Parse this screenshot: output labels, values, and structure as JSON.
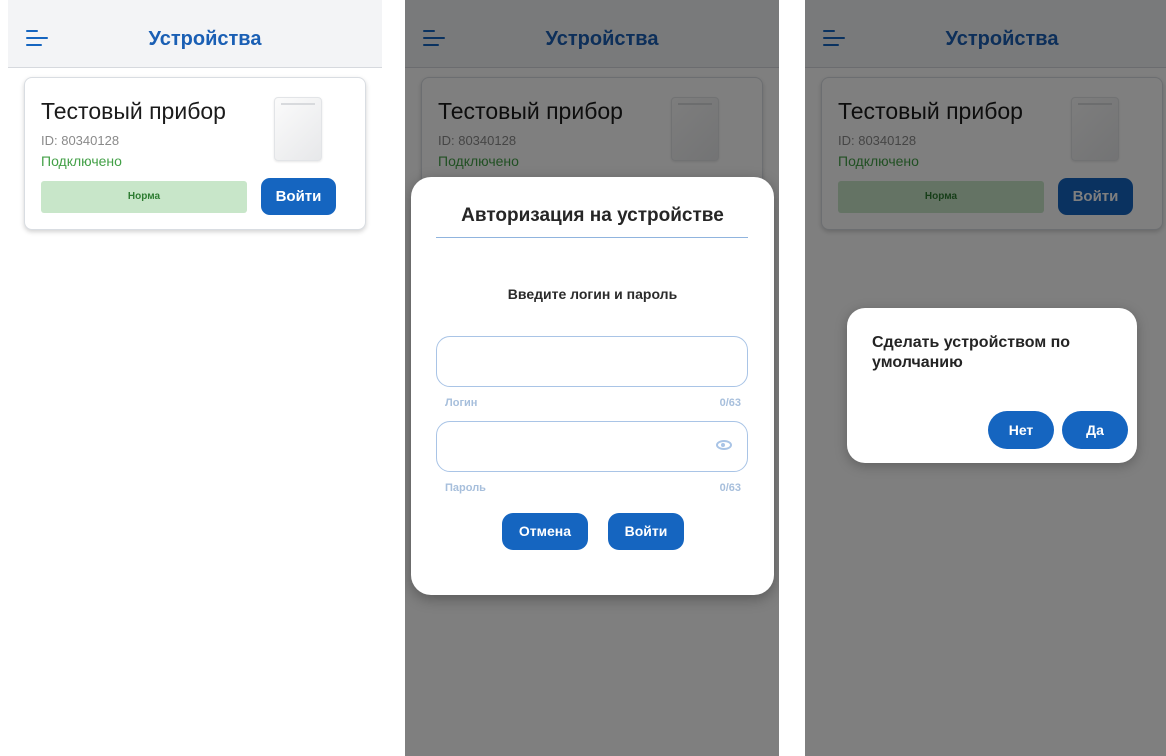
{
  "appbar": {
    "title": "Устройства",
    "menu_icon": "menu-icon"
  },
  "device": {
    "name": "Тестовый прибор",
    "id_text": "ID: 80340128",
    "status": "Подключено",
    "norm_label": "Норма",
    "login_label": "Войти"
  },
  "auth_dialog": {
    "title": "Авторизация на устройстве",
    "subtitle": "Введите логин и пароль",
    "login_field": {
      "value": "",
      "helper": "Логин",
      "counter": "0/63"
    },
    "password_field": {
      "value": "",
      "helper": "Пароль",
      "counter": "0/63",
      "icon": "eye-icon"
    },
    "cancel_label": "Отмена",
    "login_label": "Войти"
  },
  "default_dialog": {
    "message": "Сделать устройством по умолчанию",
    "no_label": "Нет",
    "yes_label": "Да"
  },
  "colors": {
    "primary": "#1565c0",
    "status_green": "#43a047",
    "norm_badge": "#c8e6c9",
    "overlay": "rgba(0,0,0,0.5)"
  }
}
